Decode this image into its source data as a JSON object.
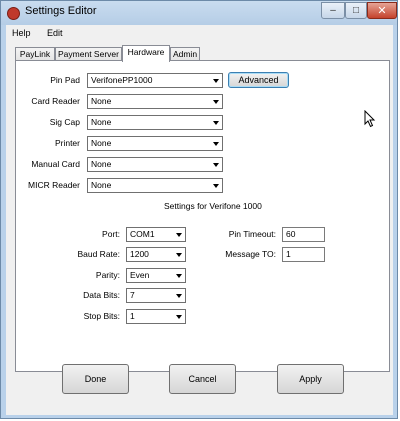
{
  "window": {
    "title": "Settings Editor"
  },
  "menu": {
    "items": [
      "Help",
      "Edit"
    ]
  },
  "tabs": [
    "PayLink",
    "Payment Server",
    "Hardware",
    "Admin"
  ],
  "active_tab": "Hardware",
  "devices": [
    {
      "label": "Pin Pad",
      "value": "VerifonePP1000"
    },
    {
      "label": "Card Reader",
      "value": "None"
    },
    {
      "label": "Sig Cap",
      "value": "None"
    },
    {
      "label": "Printer",
      "value": "None"
    },
    {
      "label": "Manual Card",
      "value": "None"
    },
    {
      "label": "MICR Reader",
      "value": "None"
    }
  ],
  "advanced_label": "Advanced",
  "settings_caption": "Settings for Verifone 1000",
  "serial": [
    {
      "label": "Port:",
      "value": "COM1"
    },
    {
      "label": "Baud Rate:",
      "value": "1200"
    },
    {
      "label": "Parity:",
      "value": "Even"
    },
    {
      "label": "Data Bits:",
      "value": "7"
    },
    {
      "label": "Stop Bits:",
      "value": "1"
    }
  ],
  "timeouts": [
    {
      "label": "Pin Timeout:",
      "value": "60"
    },
    {
      "label": "Message TO:",
      "value": "1"
    }
  ],
  "buttons": {
    "done": "Done",
    "cancel": "Cancel",
    "apply": "Apply"
  },
  "colors": {
    "window_frame": "#b9d1ea",
    "close_button": "#c4422c",
    "panel": "#ffffff"
  }
}
